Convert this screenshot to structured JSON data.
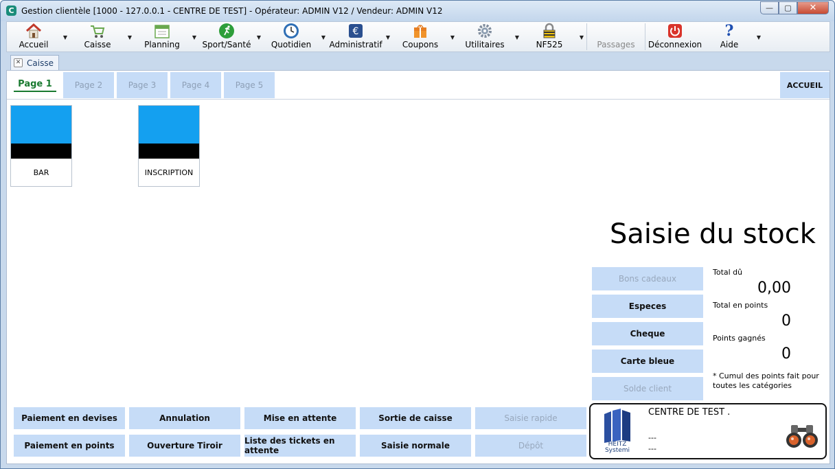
{
  "window": {
    "title": "Gestion clientèle [1000 - 127.0.0.1 - CENTRE DE TEST] - Opérateur: ADMIN V12 / Vendeur: ADMIN V12",
    "minimize": "—",
    "maximize": "▢",
    "close": "✕"
  },
  "toolbar": {
    "items": [
      {
        "label": "Accueil",
        "icon": "home-icon"
      },
      {
        "label": "Caisse",
        "icon": "cart-icon"
      },
      {
        "label": "Planning",
        "icon": "calendar-icon"
      },
      {
        "label": "Sport/Santé",
        "icon": "runner-icon"
      },
      {
        "label": "Quotidien",
        "icon": "clock-icon"
      },
      {
        "label": "Administratif",
        "icon": "euro-icon"
      },
      {
        "label": "Coupons",
        "icon": "gift-icon"
      },
      {
        "label": "Utilitaires",
        "icon": "gear-icon"
      },
      {
        "label": "NF525",
        "icon": "lock-icon"
      },
      {
        "label": "Passages",
        "icon": ""
      },
      {
        "label": "Déconnexion",
        "icon": "power-icon"
      },
      {
        "label": "Aide",
        "icon": "help-icon"
      }
    ]
  },
  "doc_tab": {
    "label": "Caisse",
    "close": "✕"
  },
  "pages": {
    "tabs": [
      "Page 1",
      "Page 2",
      "Page 3",
      "Page 4",
      "Page 5"
    ],
    "active": 0,
    "home_label": "ACCUEIL"
  },
  "tiles": [
    {
      "label": "BAR"
    },
    {
      "label": "INSCRIPTION"
    }
  ],
  "mode_title": "Saisie du stock",
  "payments": [
    {
      "label": "Bons cadeaux",
      "enabled": false
    },
    {
      "label": "Especes",
      "enabled": true
    },
    {
      "label": "Cheque",
      "enabled": true
    },
    {
      "label": "Carte bleue",
      "enabled": true
    },
    {
      "label": "Solde client",
      "enabled": false
    }
  ],
  "totals": {
    "total_du_label": "Total dû",
    "total_du_value": "0,00",
    "total_points_label": "Total en points",
    "total_points_value": "0",
    "points_gagnes_label": "Points gagnés",
    "points_gagnes_value": "0",
    "note": "* Cumul des points fait pour toutes les catégories"
  },
  "actions": {
    "row1": [
      {
        "label": "Paiement en devises",
        "enabled": true
      },
      {
        "label": "Annulation",
        "enabled": true
      },
      {
        "label": "Mise en attente",
        "enabled": true
      },
      {
        "label": "Sortie de caisse",
        "enabled": true
      },
      {
        "label": "Saisie rapide",
        "enabled": false
      }
    ],
    "row2": [
      {
        "label": "Paiement en points",
        "enabled": true
      },
      {
        "label": "Ouverture Tiroir",
        "enabled": true
      },
      {
        "label": "Liste des tickets en attente",
        "enabled": true
      },
      {
        "label": "Saisie normale",
        "enabled": true
      },
      {
        "label": "Dépôt",
        "enabled": false
      }
    ]
  },
  "shop": {
    "name": "CENTRE DE TEST .",
    "line1": "---",
    "line2": "---",
    "logo_text_1": "HEITZ",
    "logo_text_2": "Systemi"
  },
  "colors": {
    "tile_blue": "#14a0f0",
    "button_bg": "#c6dcf7",
    "active_page": "#1a7a30"
  }
}
